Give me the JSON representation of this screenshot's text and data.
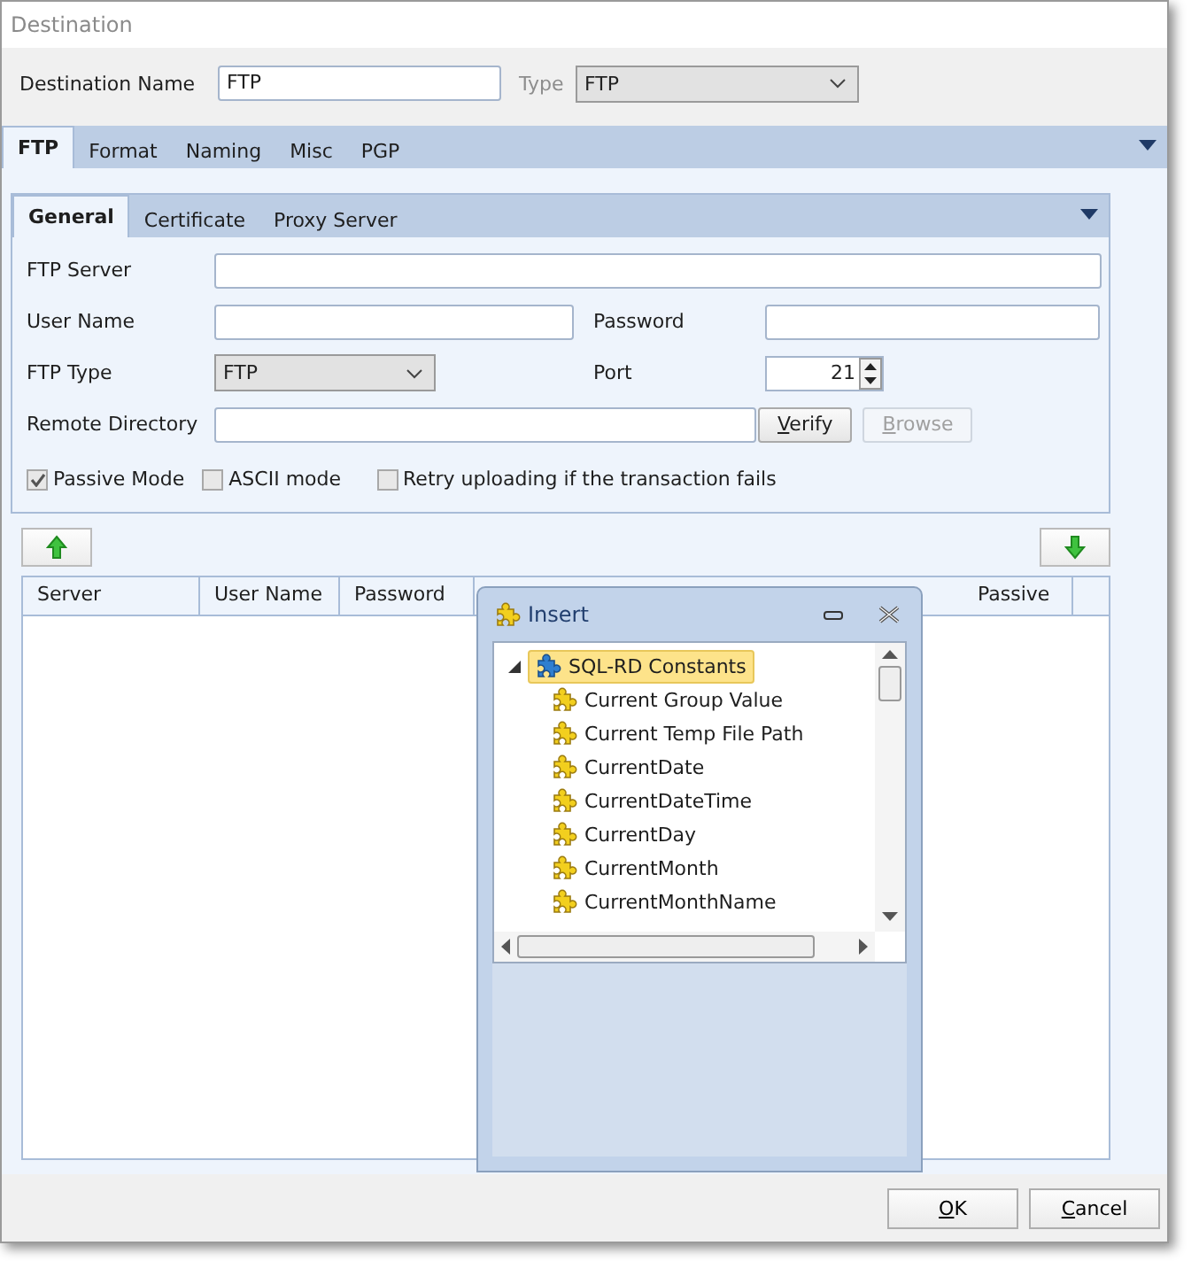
{
  "window": {
    "title": "Destination"
  },
  "destination_name": {
    "label": "Destination Name",
    "value": "FTP"
  },
  "type": {
    "label": "Type",
    "value": "FTP",
    "disabled": true
  },
  "tabs": [
    {
      "label": "FTP",
      "selected": true
    },
    {
      "label": "Format",
      "selected": false
    },
    {
      "label": "Naming",
      "selected": false
    },
    {
      "label": "Misc",
      "selected": false
    },
    {
      "label": "PGP",
      "selected": false
    }
  ],
  "sub_tabs": [
    {
      "label": "General",
      "selected": true
    },
    {
      "label": "Certificate",
      "selected": false
    },
    {
      "label": "Proxy Server",
      "selected": false
    }
  ],
  "ftp_server": {
    "label": "FTP Server"
  },
  "user_name": {
    "label": "User Name"
  },
  "password": {
    "label": "Password"
  },
  "ftp_type": {
    "label": "FTP Type",
    "value": "FTP"
  },
  "port": {
    "label": "Port",
    "value": "21"
  },
  "remote_directory": {
    "label": "Remote Directory"
  },
  "dir_buttons": [
    {
      "label": "Verify",
      "disabled": false
    },
    {
      "label": "Browse",
      "disabled": true
    }
  ],
  "checkboxes": [
    {
      "label": "Passive Mode",
      "checked": true
    },
    {
      "label": "ASCII mode",
      "checked": false
    },
    {
      "label": "Retry uploading if the transaction fails",
      "checked": false
    }
  ],
  "table": {
    "columns": [
      "Server",
      "User Name",
      "Password",
      "Passive"
    ]
  },
  "insert_panel": {
    "title": "Insert",
    "tree": [
      {
        "label": "SQL-RD Constants",
        "expanded": true,
        "selected": true,
        "children": [
          {
            "label": "Current Group Value",
            "selected": false
          },
          {
            "label": "Current Temp File Path",
            "selected": false
          },
          {
            "label": "CurrentDate",
            "selected": false
          },
          {
            "label": "CurrentDateTime",
            "selected": false
          },
          {
            "label": "CurrentDay",
            "selected": false
          },
          {
            "label": "CurrentMonth",
            "selected": false
          },
          {
            "label": "CurrentMonthName",
            "selected": false
          }
        ]
      }
    ]
  },
  "footer_buttons": [
    "OK",
    "Cancel"
  ]
}
